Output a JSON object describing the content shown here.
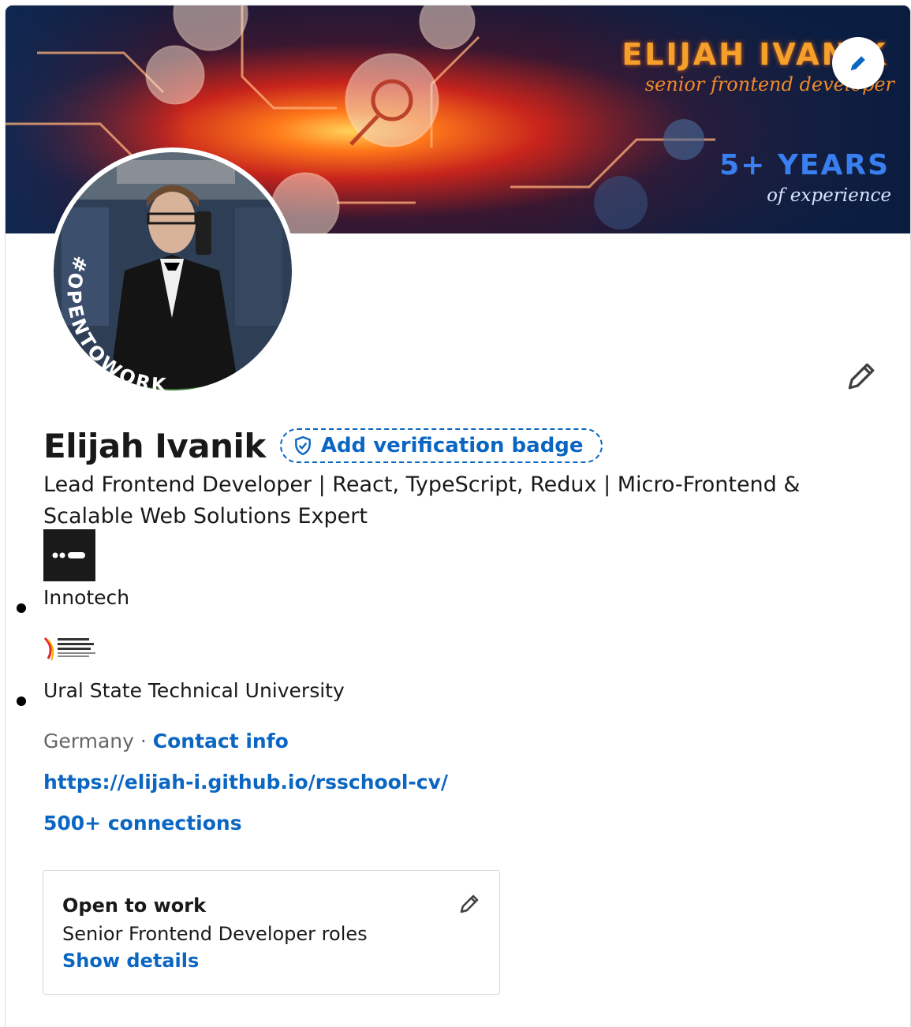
{
  "banner": {
    "line1": "ELIJAH IVANIK",
    "line2": "senior frontend developer",
    "line3": "5+ YEARS",
    "line4": "of experience"
  },
  "avatar": {
    "ring_text": "#OPENTOWORK",
    "ring_color": "#3f7a35"
  },
  "profile": {
    "name": "Elijah Ivanik",
    "verify_label": "Add verification badge",
    "headline": "Lead Frontend Developer | React, TypeScript, Redux | Micro-Frontend & Scalable Web Solutions Expert",
    "experience": [
      {
        "company": "Innotech",
        "logo_icon": "company-logo-icon"
      },
      {
        "company": "Ural State Technical University",
        "logo_icon": "university-logo-icon"
      }
    ],
    "location": "Germany",
    "separator": " · ",
    "contact_label": "Contact info",
    "website": "https://elijah-i.github.io/rsschool-cv/",
    "connections": "500+ connections"
  },
  "open_to_work": {
    "title": "Open to work",
    "subtitle": "Senior Frontend Developer roles",
    "link": "Show details"
  },
  "colors": {
    "link": "#0a66c2",
    "text": "#191919",
    "muted": "#666666"
  }
}
